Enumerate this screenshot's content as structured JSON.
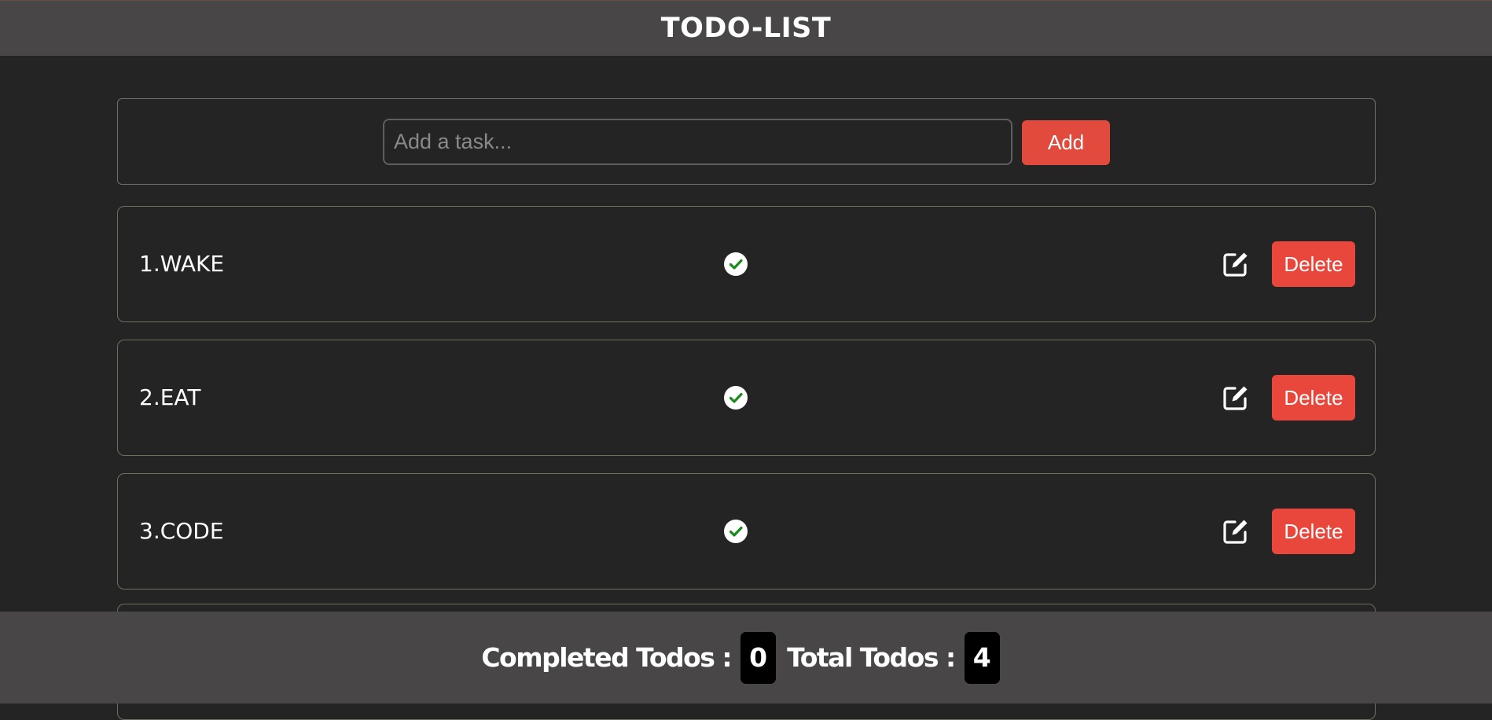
{
  "header": {
    "title": "TODO-LIST"
  },
  "add_form": {
    "placeholder": "Add a task...",
    "value": "",
    "add_label": "Add"
  },
  "todos": [
    {
      "label": "1.WAKE",
      "delete_label": "Delete"
    },
    {
      "label": "2.EAT",
      "delete_label": "Delete"
    },
    {
      "label": "3.CODE",
      "delete_label": "Delete"
    }
  ],
  "footer": {
    "completed_label": "Completed Todos :",
    "completed_count": "0",
    "total_label": "Total Todos :",
    "total_count": "4"
  },
  "colors": {
    "background": "#242424",
    "bar": "#484647",
    "accent": "#e14a3d",
    "check": "#1a8a1a"
  },
  "icons": {
    "complete": "check-circle-icon",
    "edit": "edit-icon"
  }
}
